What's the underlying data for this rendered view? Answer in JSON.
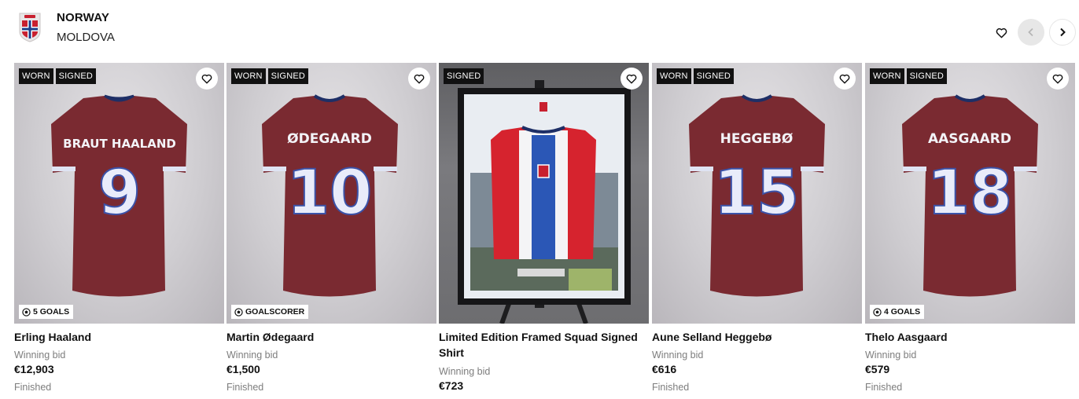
{
  "header": {
    "home_team": "NORWAY",
    "away_team": "MOLDOVA"
  },
  "colors": {
    "shirt": "#7a2a31",
    "badge_bg": "#111111",
    "muted_text": "#7d7d7d"
  },
  "cards": [
    {
      "badges": [
        "WORN",
        "SIGNED"
      ],
      "shirt_name": "BRAUT HAALAND",
      "shirt_number": "9",
      "stat": "5 GOALS",
      "title": "Erling Haaland",
      "bid_label": "Winning bid",
      "price": "€12,903",
      "status": "Finished"
    },
    {
      "badges": [
        "WORN",
        "SIGNED"
      ],
      "shirt_name": "ØDEGAARD",
      "shirt_number": "10",
      "stat": "GOALSCORER",
      "title": "Martin Ødegaard",
      "bid_label": "Winning bid",
      "price": "€1,500",
      "status": "Finished"
    },
    {
      "badges": [
        "SIGNED"
      ],
      "title": "Limited Edition Framed Squad Signed Shirt",
      "bid_label": "Winning bid",
      "price": "€723"
    },
    {
      "badges": [
        "WORN",
        "SIGNED"
      ],
      "shirt_name": "HEGGEBØ",
      "shirt_number": "15",
      "title": "Aune Selland Heggebø",
      "bid_label": "Winning bid",
      "price": "€616",
      "status": "Finished"
    },
    {
      "badges": [
        "WORN",
        "SIGNED"
      ],
      "shirt_name": "AASGAARD",
      "shirt_number": "18",
      "stat": "4 GOALS",
      "title": "Thelo Aasgaard",
      "bid_label": "Winning bid",
      "price": "€579",
      "status": "Finished"
    }
  ]
}
